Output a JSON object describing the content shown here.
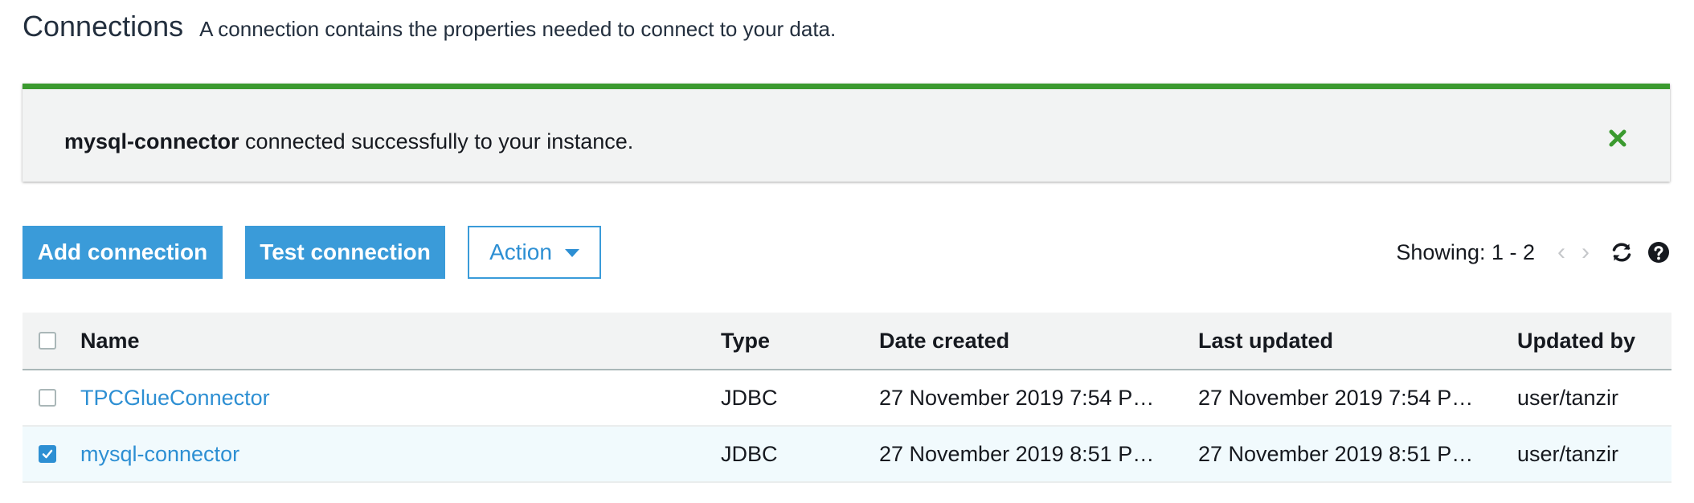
{
  "header": {
    "title": "Connections",
    "subtitle": "A connection contains the properties needed to connect to your data."
  },
  "flash": {
    "name": "mysql-connector",
    "message": " connected successfully to your instance.",
    "close_icon": "close-icon",
    "accent_color": "#3b9a2f"
  },
  "toolbar": {
    "add_label": "Add connection",
    "test_label": "Test connection",
    "action_label": "Action",
    "showing": "Showing: 1 - 2",
    "prev": "‹",
    "next": "›",
    "refresh_icon": "refresh-icon",
    "help_icon": "help-icon"
  },
  "table": {
    "columns": {
      "name": "Name",
      "type": "Type",
      "created": "Date created",
      "updated": "Last updated",
      "by": "Updated by"
    },
    "rows": [
      {
        "name": "TPCGlueConnector",
        "type": "JDBC",
        "created": "27 November 2019 7:54 P…",
        "updated": "27 November 2019 7:54 P…",
        "by": "user/tanzir",
        "selected": false
      },
      {
        "name": "mysql-connector",
        "type": "JDBC",
        "created": "27 November 2019 8:51 P…",
        "updated": "27 November 2019 8:51 P…",
        "by": "user/tanzir",
        "selected": true
      }
    ]
  },
  "colors": {
    "primary": "#3a9bd9",
    "link": "#2d8fd3",
    "success": "#3b9a2f",
    "selected_row": "#f1fafd"
  }
}
